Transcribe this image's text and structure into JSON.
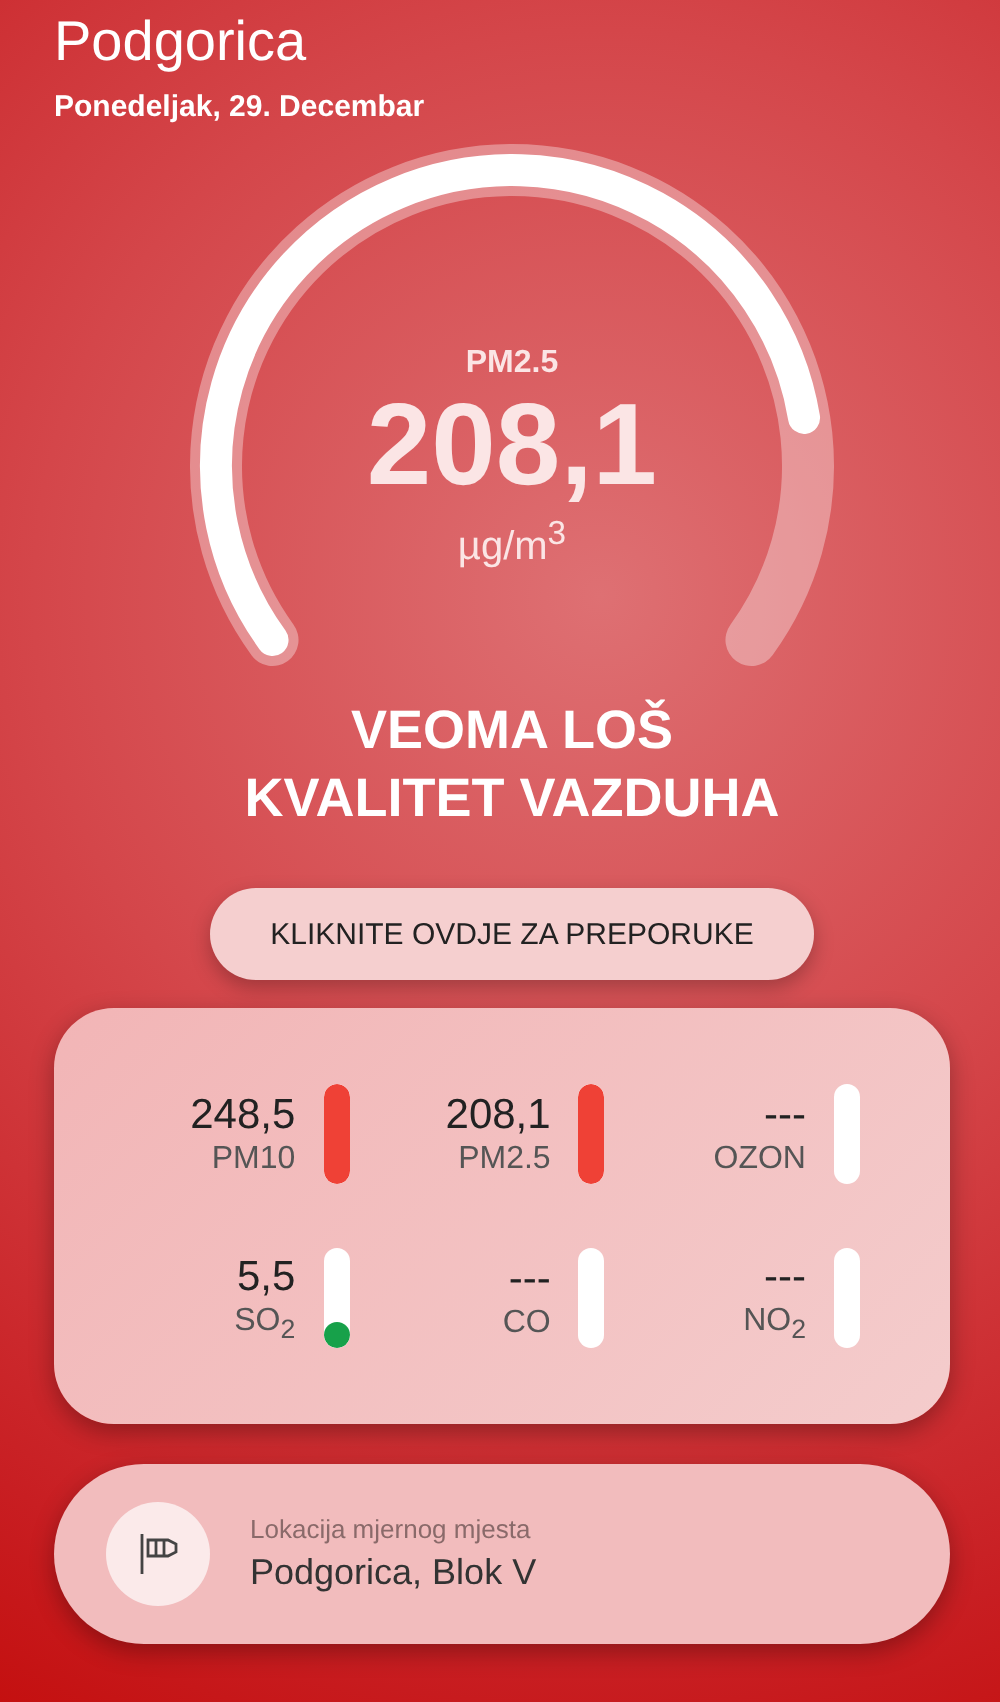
{
  "header": {
    "city": "Podgorica",
    "date": "Ponedeljak, 29. Decembar"
  },
  "gauge": {
    "label": "PM2.5",
    "value": "208,1",
    "unit": "µg/m$^{3}$"
  },
  "status": [
    "VEOMA LOŠ",
    "KVALITET VAZDUHA"
  ],
  "recommend_button": "KLIKNITE OVDJE ZA PREPORUKE",
  "pollutants": [
    {
      "value": "248,5",
      "name": "PM10",
      "level": 1,
      "color": "#ef4136"
    },
    {
      "value": "208,1",
      "name": "PM2.5",
      "level": 1,
      "color": "#ef4136"
    },
    {
      "value": "---",
      "name": "OZON"
    },
    {
      "value": "5,5",
      "name": "SO$_{2}$",
      "level": 0.1,
      "color": "#17a14a"
    },
    {
      "value": "---",
      "name": "CO"
    },
    {
      "value": "---",
      "name": "NO$_{2}$"
    }
  ],
  "location": {
    "label": "Lokacija mjernog mjesta",
    "name": "Podgorica, Blok V"
  }
}
